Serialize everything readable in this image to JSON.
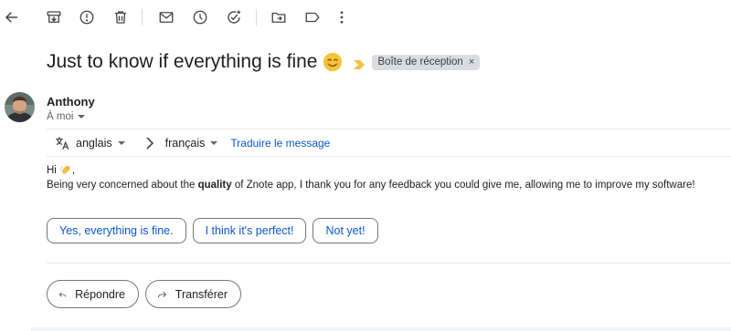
{
  "toolbar": {
    "icons": [
      "back-arrow-icon",
      "archive-icon",
      "report-spam-icon",
      "delete-icon",
      "mark-unread-icon",
      "snooze-icon",
      "add-task-icon",
      "move-to-icon",
      "label-icon",
      "more-options-icon"
    ]
  },
  "message": {
    "subject": "Just to know if everything is fine",
    "label": "Boîte de réception",
    "label_remove": "×",
    "sender": "Anthony",
    "recipient": "À moi"
  },
  "translate": {
    "source_language": "anglais",
    "target_language": "français",
    "translate_link": "Traduire le message"
  },
  "body": {
    "greeting": "Hi",
    "greeting_comma": ",",
    "line_before": "Being very concerned about the ",
    "line_bold": "quality",
    "line_after": " of Znote app, I thank you for any feedback you could give me, allowing me to improve my software!"
  },
  "smart_replies": [
    "Yes, everything is fine.",
    "I think it's perfect!",
    "Not yet!"
  ],
  "actions": {
    "reply": "Répondre",
    "forward": "Transférer"
  },
  "colors": {
    "link_blue": "#0b57d0",
    "chip_bg": "#dadce0",
    "importance_marker": "#f6c244",
    "icon_gray": "#444746"
  }
}
